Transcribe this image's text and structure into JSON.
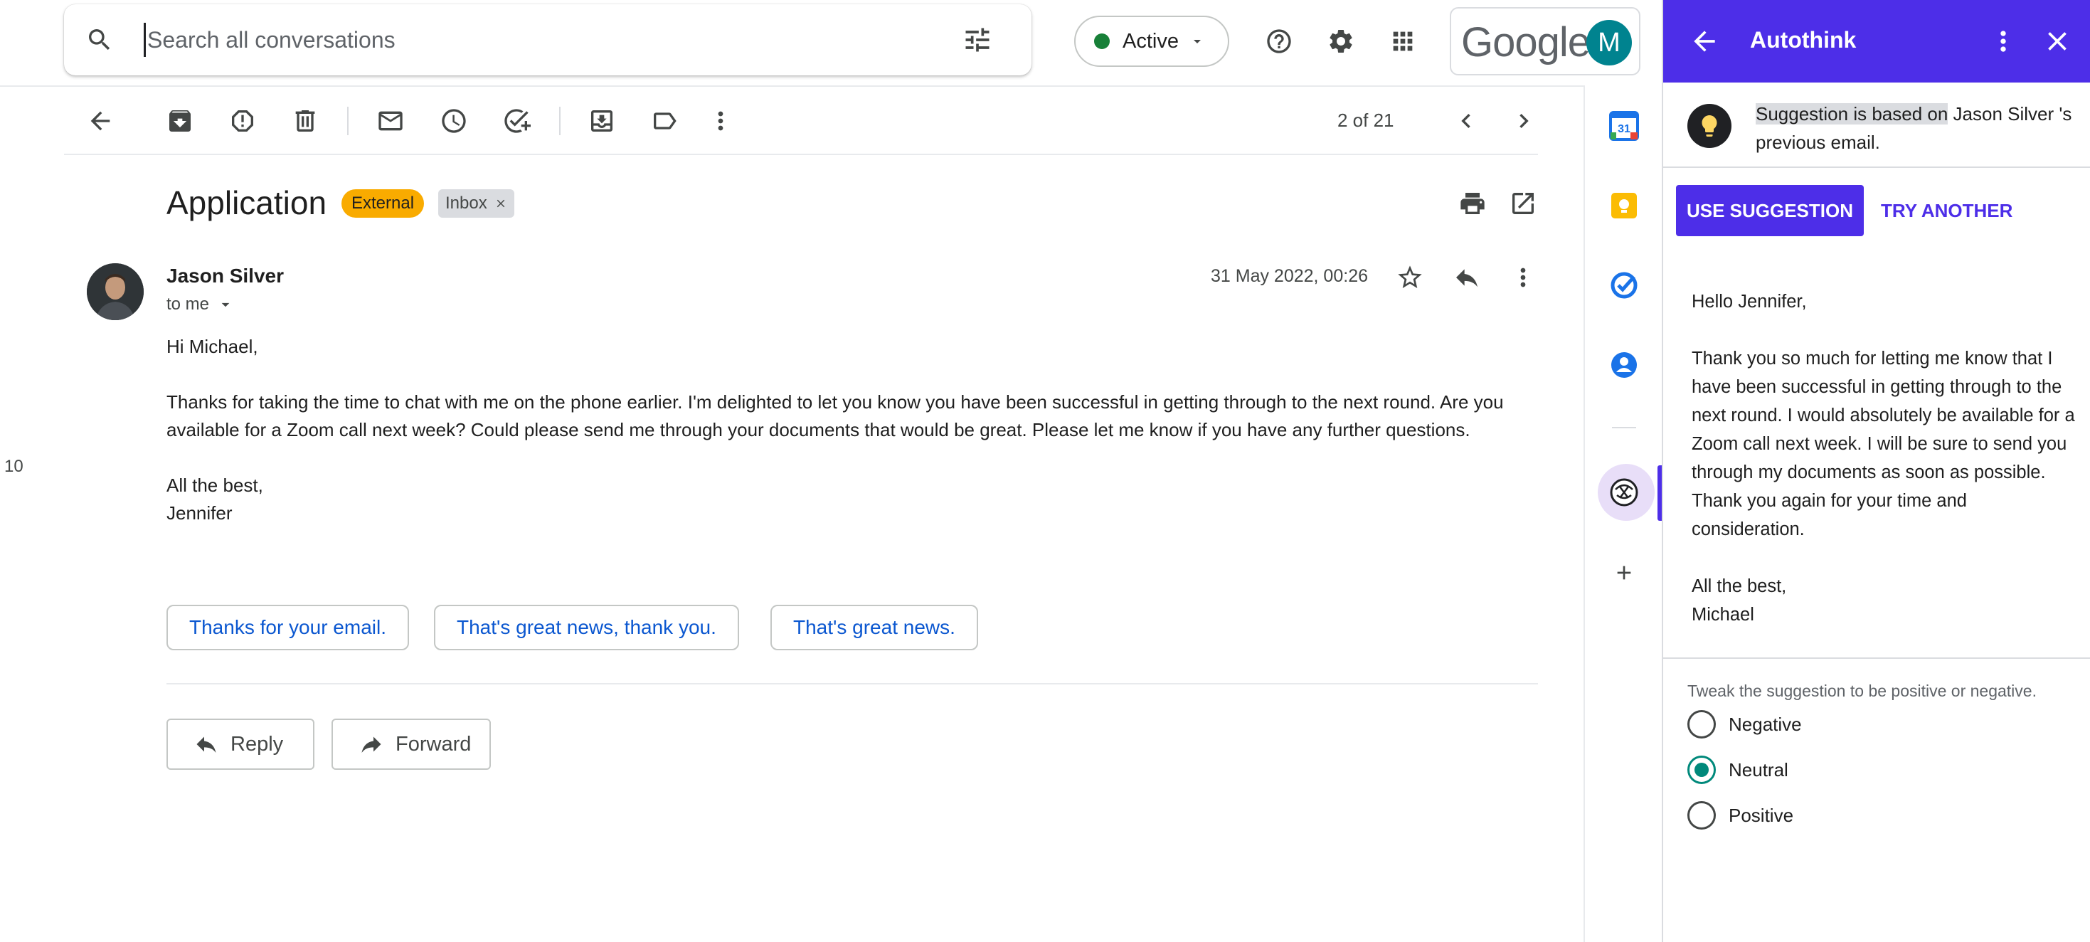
{
  "search": {
    "placeholder": "Search all conversations"
  },
  "status": {
    "label": "Active",
    "color": "#188038"
  },
  "account": {
    "brand": "Google",
    "avatar_initial": "M",
    "avatar_color": "#00838f"
  },
  "toolbar": {
    "page_count": "2 of 21"
  },
  "email": {
    "subject": "Application",
    "labels": {
      "external": "External",
      "inbox": "Inbox"
    },
    "sender": "Jason Silver",
    "recipient": "to me",
    "date": "31 May 2022, 00:26",
    "greeting": "Hi Michael,",
    "body": "Thanks for taking the time to chat with me on the phone earlier. I'm delighted to let you know you have been successful in getting through to the next round. Are you available for a Zoom call next week? Could please send me through your documents that would be great. Please let me know if you have any further questions.",
    "signoff": "All the best,",
    "signature": "Jennifer"
  },
  "stray_text": "10",
  "smart_replies": [
    "Thanks for your email.",
    "That's great news, thank you.",
    "That's great news."
  ],
  "actions": {
    "reply": "Reply",
    "forward": "Forward"
  },
  "panel": {
    "title": "Autothink",
    "note_highlight": "Suggestion is based on",
    "note_rest": " Jason Silver 's previous email.",
    "use_button": "USE SUGGESTION",
    "try_button": "TRY ANOTHER",
    "suggestion": {
      "greeting": "Hello Jennifer,",
      "body": "Thank you so much for letting me know that I have been successful in getting through to the next round. I would absolutely be available for a Zoom call next week. I will be sure to send you through my documents as soon as possible. Thank you again for your time and consideration.",
      "signoff": "All the best,",
      "signature": "Michael"
    },
    "tone_hint": "Tweak the suggestion to be positive or negative.",
    "tones": [
      "Negative",
      "Neutral",
      "Positive"
    ],
    "selected_tone": "Neutral",
    "accent_color": "#4d2ee8"
  },
  "rail": {
    "calendar_day": "31"
  }
}
